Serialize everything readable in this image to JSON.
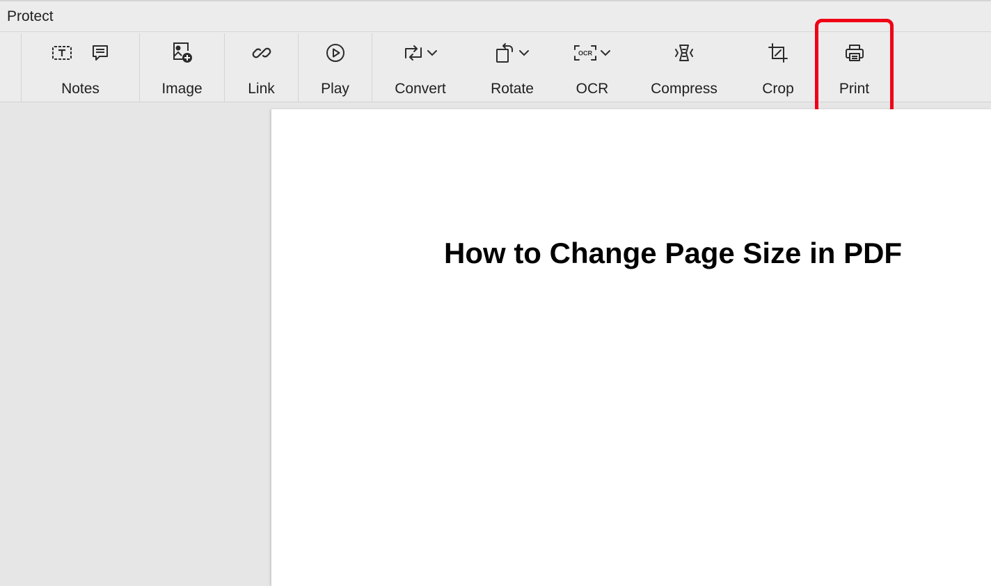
{
  "titlebar": {
    "menu_label": "Protect"
  },
  "toolbar": {
    "notes": {
      "label": "Notes",
      "icons": [
        "text-box-icon",
        "comment-icon"
      ]
    },
    "image": {
      "label": "Image",
      "icon": "image-add-icon"
    },
    "link": {
      "label": "Link",
      "icon": "link-icon"
    },
    "play": {
      "label": "Play",
      "icon": "play-icon"
    },
    "convert": {
      "label": "Convert",
      "icon": "convert-icon"
    },
    "rotate": {
      "label": "Rotate",
      "icon": "rotate-icon"
    },
    "ocr": {
      "label": "OCR",
      "icon": "ocr-icon",
      "icon_text": "OCR"
    },
    "compress": {
      "label": "Compress",
      "icon": "compress-icon"
    },
    "crop": {
      "label": "Crop",
      "icon": "crop-icon"
    },
    "print": {
      "label": "Print",
      "icon": "printer-icon",
      "highlighted": true
    }
  },
  "colors": {
    "highlight": "#f00016",
    "toolbar_bg": "#ececec",
    "workspace_bg": "#e6e6e6",
    "page_bg": "#ffffff"
  },
  "document": {
    "title": "How to Change Page Size in PDF"
  }
}
